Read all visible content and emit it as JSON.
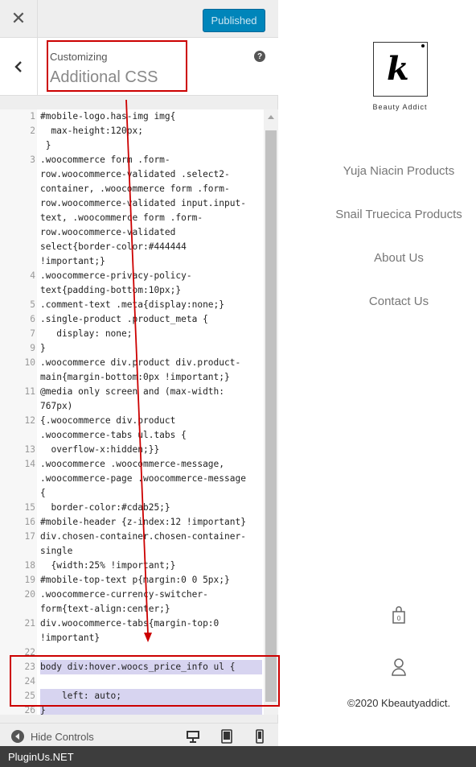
{
  "topbar": {
    "close_label": "✕",
    "publish_label": "Published"
  },
  "section": {
    "crumb": "Customizing",
    "title": "Additional CSS",
    "help_label": "?"
  },
  "editor": {
    "lines": [
      {
        "n": "1",
        "rows": [
          "#mobile-logo.has-img img{"
        ]
      },
      {
        "n": "2",
        "rows": [
          "  max-height:120px;"
        ]
      },
      {
        "n": "",
        "rows": [
          " }"
        ]
      },
      {
        "n": "3",
        "rows": [
          ".woocommerce form .form-",
          "row.woocommerce-validated .select2-",
          "container, .woocommerce form .form-",
          "row.woocommerce-validated input.input-",
          "text, .woocommerce form .form-",
          "row.woocommerce-validated",
          "select{border-color:#444444",
          "!important;}"
        ]
      },
      {
        "n": "4",
        "rows": [
          ".woocommerce-privacy-policy-",
          "text{padding-bottom:10px;}"
        ]
      },
      {
        "n": "5",
        "rows": [
          ".comment-text .meta{display:none;}"
        ]
      },
      {
        "n": "6",
        "rows": [
          ".single-product .product_meta {"
        ]
      },
      {
        "n": "7",
        "rows": [
          "   display: none;"
        ]
      },
      {
        "n": "9",
        "rows": [
          "}"
        ]
      },
      {
        "n": "10",
        "rows": [
          ".woocommerce div.product div.product-",
          "main{margin-bottom:0px !important;}"
        ]
      },
      {
        "n": "11",
        "rows": [
          "@media only screen and (max-width:",
          "767px)"
        ]
      },
      {
        "n": "12",
        "rows": [
          "{.woocommerce div.product",
          ".woocommerce-tabs ul.tabs {"
        ]
      },
      {
        "n": "13",
        "rows": [
          "  overflow-x:hidden;}}"
        ]
      },
      {
        "n": "14",
        "rows": [
          ".woocommerce .woocommerce-message,",
          ".woocommerce-page .woocommerce-message",
          "{"
        ]
      },
      {
        "n": "15",
        "rows": [
          "  border-color:#cdab25;}"
        ]
      },
      {
        "n": "16",
        "rows": [
          "#mobile-header {z-index:12 !important}"
        ]
      },
      {
        "n": "17",
        "rows": [
          "div.chosen-container.chosen-container-",
          "single"
        ]
      },
      {
        "n": "18",
        "rows": [
          "  {width:25% !important;}"
        ]
      },
      {
        "n": "19",
        "rows": [
          "#mobile-top-text p{margin:0 0 5px;}"
        ]
      },
      {
        "n": "20",
        "rows": [
          ".woocommerce-currency-switcher-",
          "form{text-align:center;}"
        ]
      },
      {
        "n": "21",
        "rows": [
          "div.woocommerce-tabs{margin-top:0",
          "!important}"
        ]
      },
      {
        "n": "22",
        "rows": [
          ""
        ]
      },
      {
        "n": "23",
        "rows": [
          "body div:hover.woocs_price_info ul {"
        ]
      },
      {
        "n": "24",
        "rows": [
          ""
        ]
      },
      {
        "n": "25",
        "rows": [
          "    left: auto;"
        ]
      },
      {
        "n": "26",
        "rows": [
          "}"
        ]
      }
    ]
  },
  "footer": {
    "hide_label": "Hide Controls"
  },
  "watermark": {
    "text": "PluginUs.NET"
  },
  "preview": {
    "logo_letter": "k",
    "logo_tagline": "Beauty Addict",
    "nav": [
      "Yuja Niacin Products",
      "Snail Truecica Products",
      "About Us",
      "Contact Us"
    ],
    "copyright": "©2020 Kbeautyaddict."
  },
  "colors": {
    "publish": "#0085ba",
    "annotation": "#cc0000",
    "selection": "#d7d4f0"
  }
}
